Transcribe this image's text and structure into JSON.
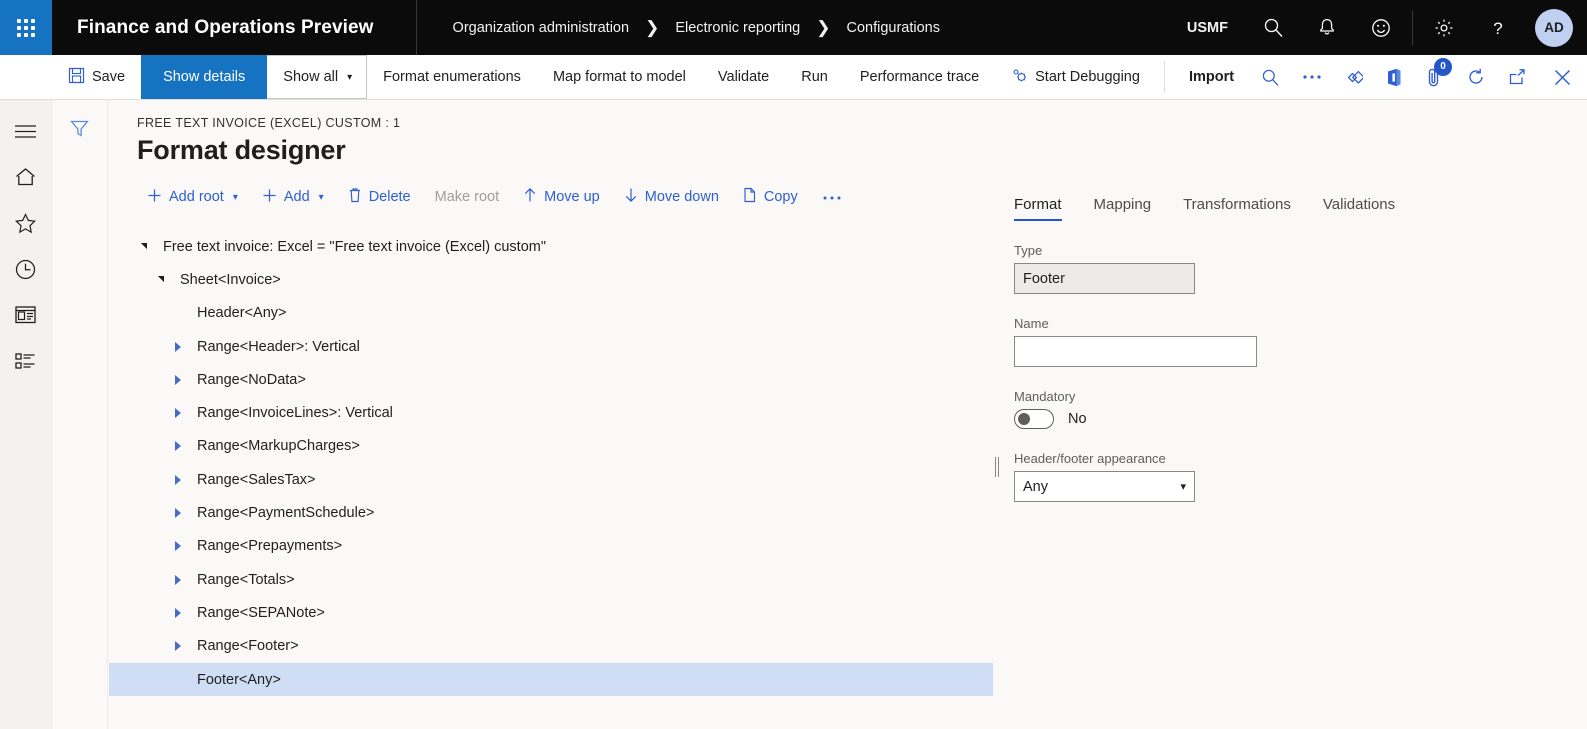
{
  "header": {
    "app_title": "Finance and Operations Preview",
    "waffle_icon": "waffle-icon",
    "breadcrumb": [
      "Organization administration",
      "Electronic reporting",
      "Configurations"
    ],
    "company": "USMF",
    "icons": [
      "search-icon",
      "bell-icon",
      "feedback-smiley-icon",
      "settings-gear-icon",
      "help-question-icon"
    ],
    "avatar_initials": "AD"
  },
  "action_pane": {
    "save_label": "Save",
    "show_details_label": "Show details",
    "show_all_label": "Show all",
    "items": [
      "Format enumerations",
      "Map format to model",
      "Validate",
      "Run",
      "Performance trace"
    ],
    "start_debugging_label": "Start Debugging",
    "import_label": "Import",
    "right_icons": [
      "search-icon",
      "overflow-ellipsis-icon",
      "power-bi-icon",
      "office-icon",
      "attachments-icon",
      "refresh-icon",
      "open-in-new-window-icon",
      "close-icon"
    ],
    "attachments_badge": "0"
  },
  "nav_rail": {
    "icons": [
      "hamburger-menu-icon",
      "home-icon",
      "favorites-star-icon",
      "recent-clock-icon",
      "workspaces-icon",
      "modules-list-icon"
    ]
  },
  "filter_rail": {
    "icon": "filter-funnel-icon"
  },
  "page": {
    "caption": "FREE TEXT INVOICE (EXCEL) CUSTOM : 1",
    "title": "Format designer"
  },
  "designer_toolbar": {
    "buttons": [
      {
        "label": "Add root",
        "icon": "plus-icon",
        "caret": true,
        "disabled": false
      },
      {
        "label": "Add",
        "icon": "plus-icon",
        "caret": true,
        "disabled": false
      },
      {
        "label": "Delete",
        "icon": "trash-icon",
        "caret": false,
        "disabled": false
      },
      {
        "label": "Make root",
        "icon": "",
        "caret": false,
        "disabled": true
      },
      {
        "label": "Move up",
        "icon": "arrow-up-icon",
        "caret": false,
        "disabled": false
      },
      {
        "label": "Move down",
        "icon": "arrow-down-icon",
        "caret": false,
        "disabled": false
      },
      {
        "label": "Copy",
        "icon": "copy-icon",
        "caret": false,
        "disabled": false
      },
      {
        "label": "…",
        "icon": "overflow-ellipsis-icon",
        "caret": false,
        "disabled": false
      }
    ]
  },
  "tree": {
    "rows": [
      {
        "label": "Free text invoice: Excel = \"Free text invoice (Excel) custom\"",
        "indent": 0,
        "expander": "expanded",
        "selected": false
      },
      {
        "label": "Sheet<Invoice>",
        "indent": 1,
        "expander": "expanded",
        "selected": false
      },
      {
        "label": "Header<Any>",
        "indent": 2,
        "expander": "none",
        "selected": false
      },
      {
        "label": "Range<Header>: Vertical",
        "indent": 2,
        "expander": "collapsed",
        "selected": false
      },
      {
        "label": "Range<NoData>",
        "indent": 2,
        "expander": "collapsed",
        "selected": false
      },
      {
        "label": "Range<InvoiceLines>: Vertical",
        "indent": 2,
        "expander": "collapsed",
        "selected": false
      },
      {
        "label": "Range<MarkupCharges>",
        "indent": 2,
        "expander": "collapsed",
        "selected": false
      },
      {
        "label": "Range<SalesTax>",
        "indent": 2,
        "expander": "collapsed",
        "selected": false
      },
      {
        "label": "Range<PaymentSchedule>",
        "indent": 2,
        "expander": "collapsed",
        "selected": false
      },
      {
        "label": "Range<Prepayments>",
        "indent": 2,
        "expander": "collapsed",
        "selected": false
      },
      {
        "label": "Range<Totals>",
        "indent": 2,
        "expander": "collapsed",
        "selected": false
      },
      {
        "label": "Range<SEPANote>",
        "indent": 2,
        "expander": "collapsed",
        "selected": false
      },
      {
        "label": "Range<Footer>",
        "indent": 2,
        "expander": "collapsed",
        "selected": false
      },
      {
        "label": "Footer<Any>",
        "indent": 2,
        "expander": "none",
        "selected": true
      }
    ]
  },
  "properties": {
    "tabs": [
      {
        "label": "Format",
        "active": true
      },
      {
        "label": "Mapping",
        "active": false
      },
      {
        "label": "Transformations",
        "active": false
      },
      {
        "label": "Validations",
        "active": false
      }
    ],
    "type_label": "Type",
    "type_value": "Footer",
    "name_label": "Name",
    "name_value": "",
    "name_placeholder": "",
    "mandatory_label": "Mandatory",
    "mandatory_value": "No",
    "appearance_label": "Header/footer appearance",
    "appearance_value": "Any"
  },
  "colors": {
    "brand_blue": "#1673C2",
    "link_blue": "#2F5FD0",
    "selected_row": "#CFDDF5",
    "header_black": "#0B0B0B",
    "page_bg": "#FAF9F8"
  }
}
